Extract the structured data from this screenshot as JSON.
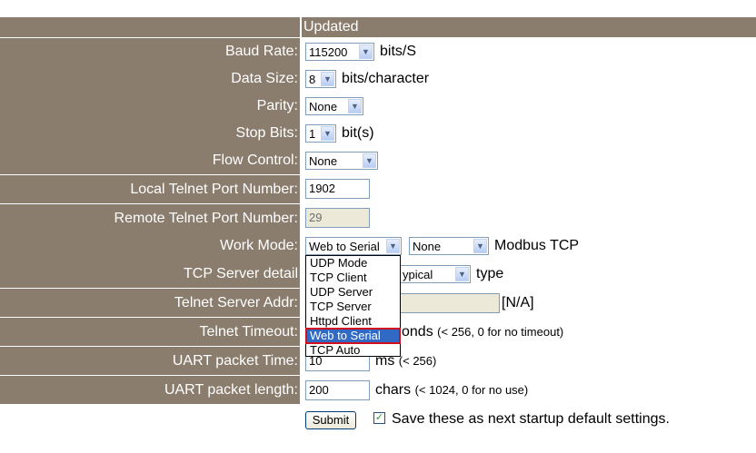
{
  "header": {
    "status": "Updated"
  },
  "labels": {
    "baud_rate": "Baud Rate:",
    "data_size": "Data Size:",
    "parity": "Parity:",
    "stop_bits": "Stop Bits:",
    "flow_control": "Flow Control:",
    "local_port": "Local Telnet Port Number:",
    "remote_port": "Remote Telnet Port Number:",
    "work_mode": "Work Mode:",
    "tcp_server_detail": "TCP Server detail",
    "telnet_server_addr": "Telnet Server Addr:",
    "telnet_timeout": "Telnet Timeout:",
    "uart_packet_time": "UART packet Time:",
    "uart_packet_length": "UART packet length:"
  },
  "values": {
    "baud_rate": "115200",
    "baud_unit": "bits/S",
    "data_size": "8",
    "data_unit": "bits/character",
    "parity": "None",
    "stop_bits": "1",
    "stop_unit": "bit(s)",
    "flow_control": "None",
    "local_port": "1902",
    "remote_port": "29",
    "work_mode": "Web to Serial",
    "modbus_mode": "None",
    "modbus_unit": "Modbus TCP",
    "tcp_detail": "ypical",
    "tcp_detail_unit": "type",
    "server_addr_unit": "[N/A]",
    "timeout_unit": "onds",
    "timeout_hint": "(< 256, 0 for no timeout)",
    "uart_time": "10",
    "uart_time_unit": "ms",
    "uart_time_hint": "(< 256)",
    "uart_length": "200",
    "uart_length_unit": "chars",
    "uart_length_hint": "(< 1024, 0 for no use)"
  },
  "dropdown": {
    "items": [
      "UDP Mode",
      "TCP Client",
      "UDP Server",
      "TCP Server",
      "Httpd Client",
      "Web to Serial",
      "TCP Auto"
    ],
    "selected_index": 5
  },
  "footer": {
    "submit_label": "Submit",
    "checkbox_checked": true,
    "checkbox_label": "Save these as next startup default settings."
  },
  "colors": {
    "label_bg": "#8a7d6e",
    "selected": "#316ac5",
    "highlight_border": "#d0101c"
  }
}
